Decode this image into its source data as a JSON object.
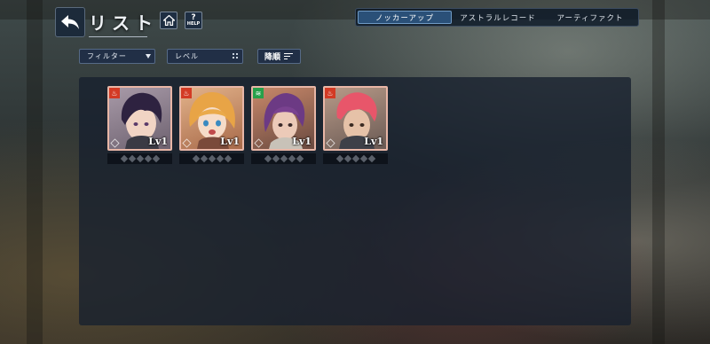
{
  "header": {
    "title": "リスト",
    "help_label": "HELP",
    "help_symbol": "?"
  },
  "tabs": [
    {
      "label": "ノッカーアップ",
      "active": true
    },
    {
      "label": "アストラルレコード",
      "active": false
    },
    {
      "label": "アーティファクト",
      "active": false
    }
  ],
  "filters": {
    "filter_label": "フィルター",
    "level_label": "レベル",
    "sort_label": "降順"
  },
  "cards": [
    {
      "level_text": "Lv1",
      "attribute_icon": "fire-icon",
      "attribute_color": "#d33a24",
      "hair_color": "#3a2a4a",
      "bg_color": "#8a7c88",
      "rank_filled": 0,
      "rank_total": 5
    },
    {
      "level_text": "Lv1",
      "attribute_icon": "fire-icon",
      "attribute_color": "#d33a24",
      "hair_color": "#e0a040",
      "bg_color": "#c88a60",
      "rank_filled": 0,
      "rank_total": 5
    },
    {
      "level_text": "Lv1",
      "attribute_icon": "wind-icon",
      "attribute_color": "#27a04a",
      "hair_color": "#6a3a80",
      "bg_color": "#9a6a5a",
      "rank_filled": 0,
      "rank_total": 5
    },
    {
      "level_text": "Lv1",
      "attribute_icon": "fire-icon",
      "attribute_color": "#d33a24",
      "hair_color": "#e05a6a",
      "bg_color": "#b08070",
      "rank_filled": 0,
      "rank_total": 5
    }
  ],
  "colors": {
    "accent": "#2a5078",
    "panel": "#18202e",
    "card_border": "#e8b6a6"
  }
}
